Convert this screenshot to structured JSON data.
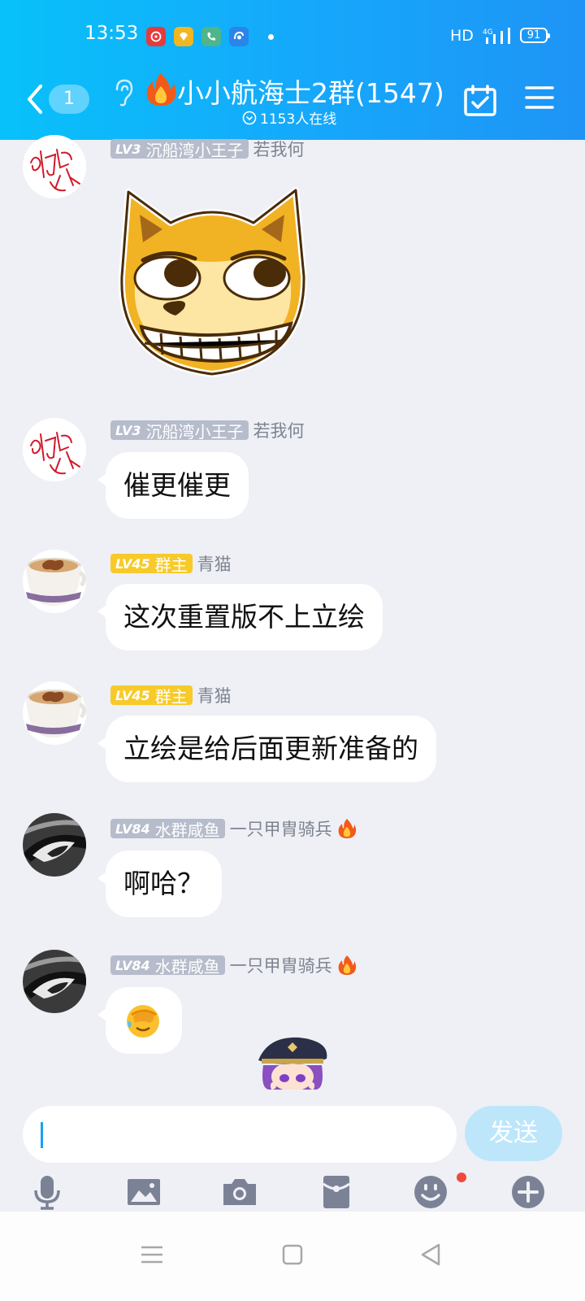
{
  "status_bar": {
    "time": "13:53",
    "network": "HD",
    "cell_label": "4G",
    "battery": "91",
    "notification_icons": [
      "netease-music-icon",
      "vip-diamond-icon",
      "phone-app-icon",
      "browser-app-icon"
    ],
    "notification_colors": [
      "#e33c3c",
      "#f2b620",
      "#4fb58a",
      "#2b84e8"
    ]
  },
  "header": {
    "unread_count": "1",
    "group_name": "小小航海士2群(1547)",
    "online_count": "1153人在线",
    "colors": {
      "gradient_start": "#08c1fa",
      "gradient_end": "#1e94f6"
    }
  },
  "messages": [
    {
      "level": "LV3",
      "title": "沉船湾小王子",
      "nickname": "若我何",
      "type": "sticker",
      "sticker": "doge-grin-sticker",
      "title_badge_color": "#b6bccb"
    },
    {
      "level": "LV3",
      "title": "沉船湾小王子",
      "nickname": "若我何",
      "type": "text",
      "text": "催更催更",
      "title_badge_color": "#b6bccb"
    },
    {
      "level": "LV45",
      "title": "群主",
      "nickname": "青猫",
      "type": "text",
      "text": "这次重置版不上立绘",
      "title_badge_color": "#f7ca2a"
    },
    {
      "level": "LV45",
      "title": "群主",
      "nickname": "青猫",
      "type": "text",
      "text": "立绘是给后面更新准备的",
      "title_badge_color": "#f7ca2a"
    },
    {
      "level": "LV84",
      "title": "水群咸鱼",
      "nickname": "一只甲胄骑兵",
      "type": "text",
      "text": "啊哈？",
      "title_badge_color": "#b6bccb"
    },
    {
      "level": "LV84",
      "title": "水群咸鱼",
      "nickname": "一只甲胄骑兵",
      "type": "emoji",
      "emoji": "facepalm-emoji",
      "title_badge_color": "#b6bccb"
    }
  ],
  "input": {
    "value": "",
    "placeholder": ""
  },
  "send_button": {
    "label": "发送",
    "color": "#bde6fb"
  },
  "toolbar": [
    "microphone-icon",
    "image-icon",
    "camera-icon",
    "red-packet-icon",
    "emoji-icon",
    "plus-icon"
  ],
  "toolbar_notification": {
    "item": "emoji-icon",
    "color": "#f04a3d"
  },
  "nav_bar": [
    "menu-nav-icon",
    "home-nav-icon",
    "back-nav-icon"
  ]
}
